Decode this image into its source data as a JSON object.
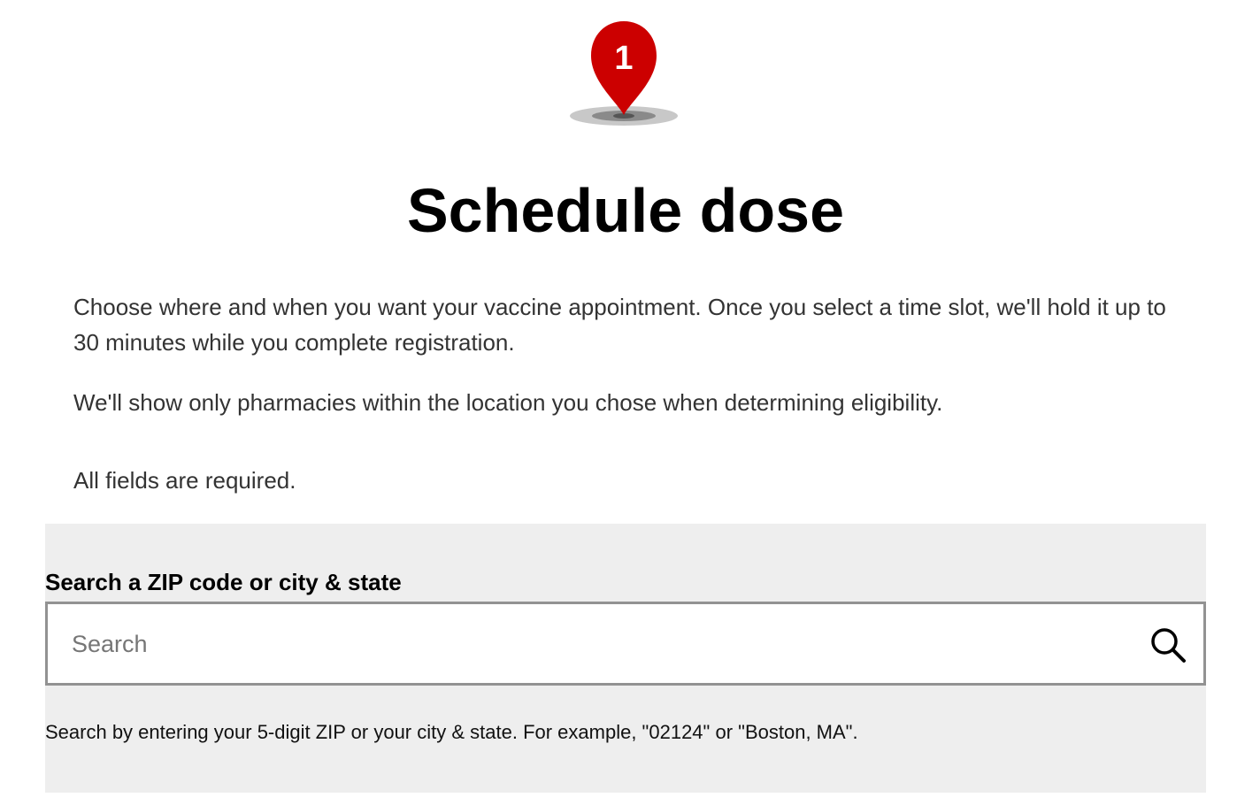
{
  "step": {
    "number": "1",
    "pin_color": "#cc0000"
  },
  "page_title": "Schedule dose",
  "intro": {
    "paragraph_1": "Choose where and when you want your vaccine appointment. Once you select a time slot, we'll hold it up to 30 minutes while you complete registration.",
    "paragraph_2": "We'll show only pharmacies within the location you chose when determining eligibility."
  },
  "required_note": "All fields are required.",
  "search": {
    "label": "Search a ZIP code or city & state",
    "placeholder": "Search",
    "value": "",
    "button_icon": "search-icon",
    "helper": "Search by entering your 5-digit ZIP or your city & state. For example, \"02124\" or \"Boston, MA\"."
  }
}
